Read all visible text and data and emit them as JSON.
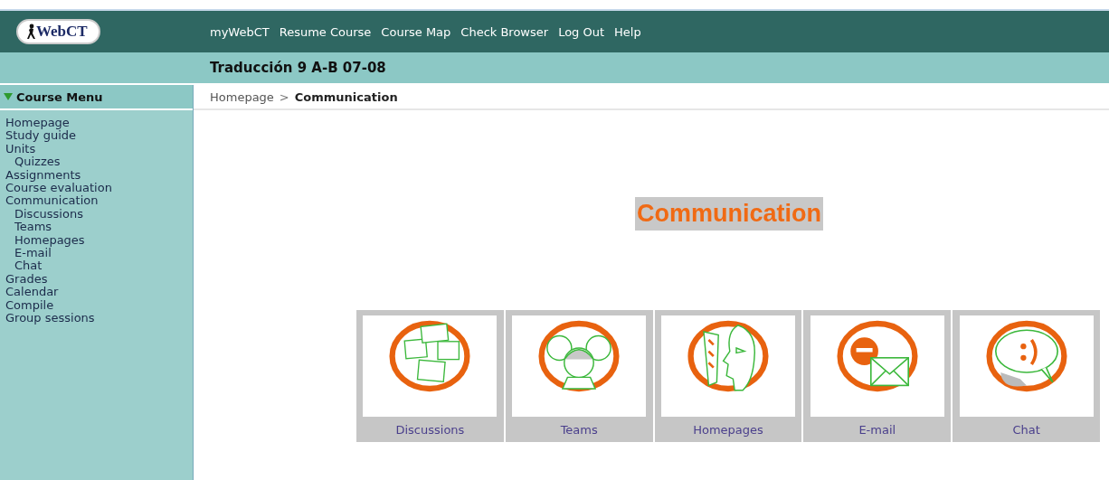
{
  "logo": {
    "text": "WebCT"
  },
  "nav": [
    "myWebCT",
    "Resume Course",
    "Course Map",
    "Check Browser",
    "Log Out",
    "Help"
  ],
  "course_title": "Traducción 9 A-B 07-08",
  "sidebar": {
    "title": "Course Menu",
    "expanded": true,
    "items": [
      {
        "label": "Homepage"
      },
      {
        "label": "Study guide"
      },
      {
        "label": "Units",
        "children": [
          {
            "label": "Quizzes"
          }
        ]
      },
      {
        "label": "Assignments"
      },
      {
        "label": "Course evaluation"
      },
      {
        "label": "Communication",
        "children": [
          {
            "label": "Discussions"
          },
          {
            "label": "Teams"
          },
          {
            "label": "Homepages"
          },
          {
            "label": "E-mail"
          },
          {
            "label": "Chat"
          }
        ]
      },
      {
        "label": "Grades"
      },
      {
        "label": "Calendar"
      },
      {
        "label": "Compile"
      },
      {
        "label": "Group sessions"
      }
    ]
  },
  "breadcrumb": {
    "parent": "Homepage",
    "separator": ">",
    "current": "Communication"
  },
  "heading": "Communication",
  "tools": [
    {
      "label": "Discussions",
      "kind": "discussions"
    },
    {
      "label": "Teams",
      "kind": "teams"
    },
    {
      "label": "Homepages",
      "kind": "homepages"
    },
    {
      "label": "E-mail",
      "kind": "email"
    },
    {
      "label": "Chat",
      "kind": "chat"
    }
  ]
}
